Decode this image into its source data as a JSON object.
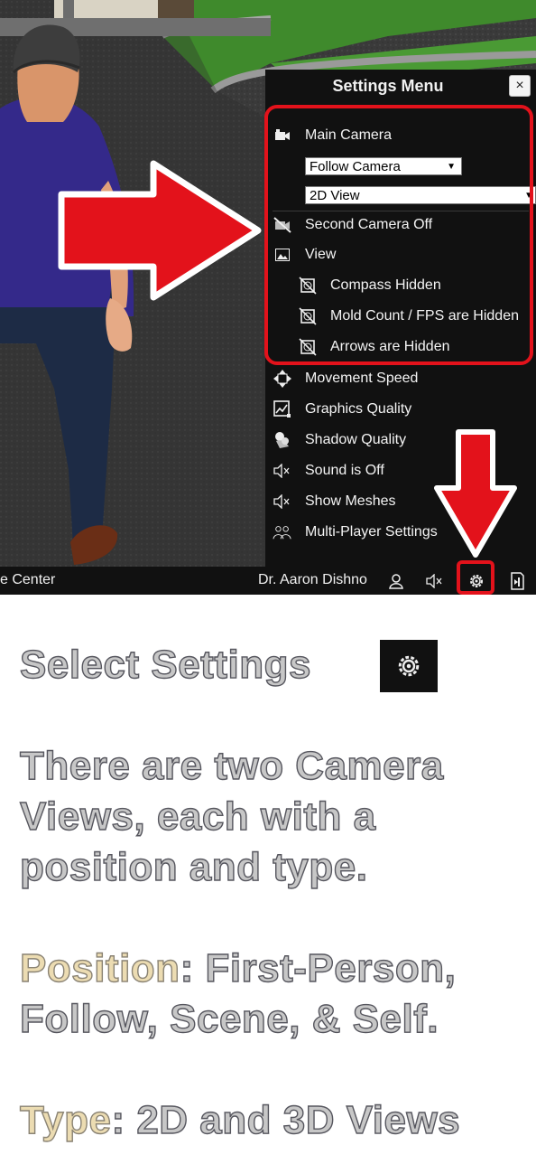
{
  "panel": {
    "title": "Settings Menu",
    "close_label": "×",
    "items": {
      "main_camera": "Main Camera",
      "second_camera": "Second Camera Off",
      "view": "View",
      "compass": "Compass Hidden",
      "mold_count": "Mold Count / FPS are Hidden",
      "arrows": "Arrows are Hidden",
      "movement_speed": "Movement Speed",
      "graphics_quality": "Graphics Quality",
      "shadow_quality": "Shadow Quality",
      "sound": "Sound is Off",
      "show_meshes": "Show Meshes",
      "multiplayer": "Multi-Player Settings"
    },
    "camera_position_select": "Follow Camera",
    "camera_type_select": "2D View"
  },
  "bottom_bar": {
    "left_text": "e Center",
    "user_name": "Dr. Aaron Dishno"
  },
  "instructions": {
    "line1": "Select Settings",
    "para2": [
      "There are two Camera",
      "Views, each with a",
      "position and type."
    ],
    "position_label": "Position",
    "position_rest": ": First-Person,",
    "position_line2": "Follow, Scene, & Self.",
    "type_label": "Type",
    "type_rest": ": 2D and 3D Views"
  },
  "colors": {
    "highlight_red": "#e3121b",
    "panel_bg": "#111111",
    "accent_text": "#ecdcb2"
  },
  "icons": [
    "video-camera-icon",
    "camera-off-icon",
    "image-icon",
    "compass-off-icon",
    "move-arrows-icon",
    "graphics-icon",
    "shadow-icon",
    "sound-mute-icon",
    "user-icon",
    "settings-gear-icon",
    "exit-icon"
  ]
}
